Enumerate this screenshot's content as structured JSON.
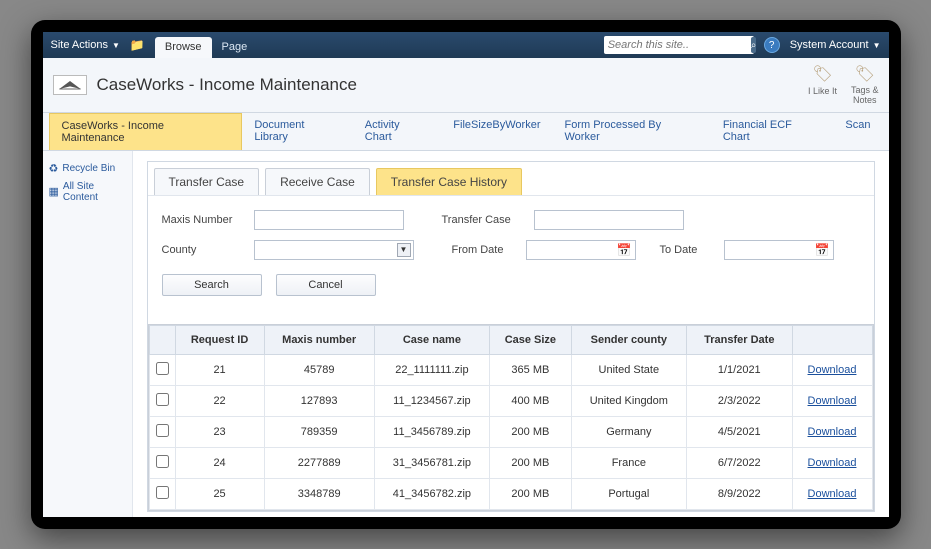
{
  "ribbon": {
    "site_actions": "Site Actions",
    "browse": "Browse",
    "page": "Page",
    "search_placeholder": "Search this site..",
    "system_account": "System Account"
  },
  "header": {
    "title": "CaseWorks - Income Maintenance",
    "like_label": "I Like It",
    "tags_label": "Tags &\nNotes"
  },
  "topnav": [
    "CaseWorks - Income Maintenance",
    "Document Library",
    "Activity Chart",
    "FileSizeByWorker",
    "Form Processed By Worker",
    "Financial ECF Chart",
    "Scan"
  ],
  "leftnav": {
    "recycle": "Recycle Bin",
    "all_content": "All Site Content"
  },
  "content_tabs": {
    "transfer": "Transfer Case",
    "receive": "Receive Case",
    "history": "Transfer Case History"
  },
  "filters": {
    "maxis_label": "Maxis Number",
    "transfer_label": "Transfer Case",
    "county_label": "County",
    "from_label": "From Date",
    "to_label": "To Date",
    "search_btn": "Search",
    "cancel_btn": "Cancel"
  },
  "table": {
    "headers": {
      "chk": "",
      "request_id": "Request ID",
      "maxis": "Maxis number",
      "case_name": "Case name",
      "case_size": "Case Size",
      "sender": "Sender county",
      "transfer_date": "Transfer Date",
      "action": ""
    },
    "download_label": "Download",
    "rows": [
      {
        "request_id": "21",
        "maxis": "45789",
        "case_name": "22_1111111.zip",
        "case_size": "365 MB",
        "sender": "United State",
        "transfer_date": "1/1/2021"
      },
      {
        "request_id": "22",
        "maxis": "127893",
        "case_name": "11_1234567.zip",
        "case_size": "400 MB",
        "sender": "United Kingdom",
        "transfer_date": "2/3/2022"
      },
      {
        "request_id": "23",
        "maxis": "789359",
        "case_name": "11_3456789.zip",
        "case_size": "200 MB",
        "sender": "Germany",
        "transfer_date": "4/5/2021"
      },
      {
        "request_id": "24",
        "maxis": "2277889",
        "case_name": "31_3456781.zip",
        "case_size": "200 MB",
        "sender": "France",
        "transfer_date": "6/7/2022"
      },
      {
        "request_id": "25",
        "maxis": "3348789",
        "case_name": "41_3456782.zip",
        "case_size": "200 MB",
        "sender": "Portugal",
        "transfer_date": "8/9/2022"
      }
    ]
  }
}
